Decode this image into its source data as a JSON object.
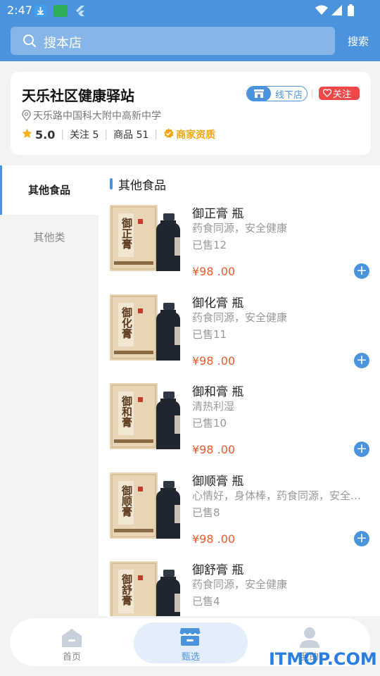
{
  "status_bar": {
    "time": "2:47"
  },
  "search": {
    "placeholder": "搜本店",
    "button_label": "搜索"
  },
  "store": {
    "name": "天乐社区健康驿站",
    "address": "天乐路中国科大附中高新中学",
    "rating": "5.0",
    "follow_count": "关注 5",
    "product_count": "商品 51",
    "verified_label": "商家资质",
    "offline_tag": "线下店",
    "follow_button": "关注"
  },
  "categories": [
    {
      "label": "其他食品",
      "active": true
    },
    {
      "label": "其他类",
      "active": false
    }
  ],
  "section_title": "其他食品",
  "products": [
    {
      "name": "御正膏 瓶",
      "desc": "药食同源，安全健康",
      "sold": "已售12",
      "price": "¥98 .00",
      "box_text": "御正膏"
    },
    {
      "name": "御化膏 瓶",
      "desc": "药食同源，安全健康",
      "sold": "已售11",
      "price": "¥98 .00",
      "box_text": "御化膏"
    },
    {
      "name": "御和膏 瓶",
      "desc": "清热利湿",
      "sold": "已售10",
      "price": "¥98 .00",
      "box_text": "御和膏"
    },
    {
      "name": "御顺膏 瓶",
      "desc": "心情好，身体棒，药食同源，安全健康",
      "sold": "已售8",
      "price": "¥98 .00",
      "box_text": "御顺膏"
    },
    {
      "name": "御舒膏 瓶",
      "desc": "药食同源，安全健康",
      "sold": "已售4",
      "price": "¥98 .00",
      "box_text": "御舒膏"
    }
  ],
  "tabs": [
    {
      "label": "首页",
      "icon": "home-icon"
    },
    {
      "label": "甄选",
      "icon": "shop-icon",
      "active": true
    },
    {
      "label": "我的",
      "icon": "user-icon"
    }
  ],
  "watermark": "ITMOP.COM",
  "colors": {
    "primary": "#4b94dd",
    "price": "#f05a2a",
    "follow": "#f04848",
    "verified": "#f3a712"
  }
}
